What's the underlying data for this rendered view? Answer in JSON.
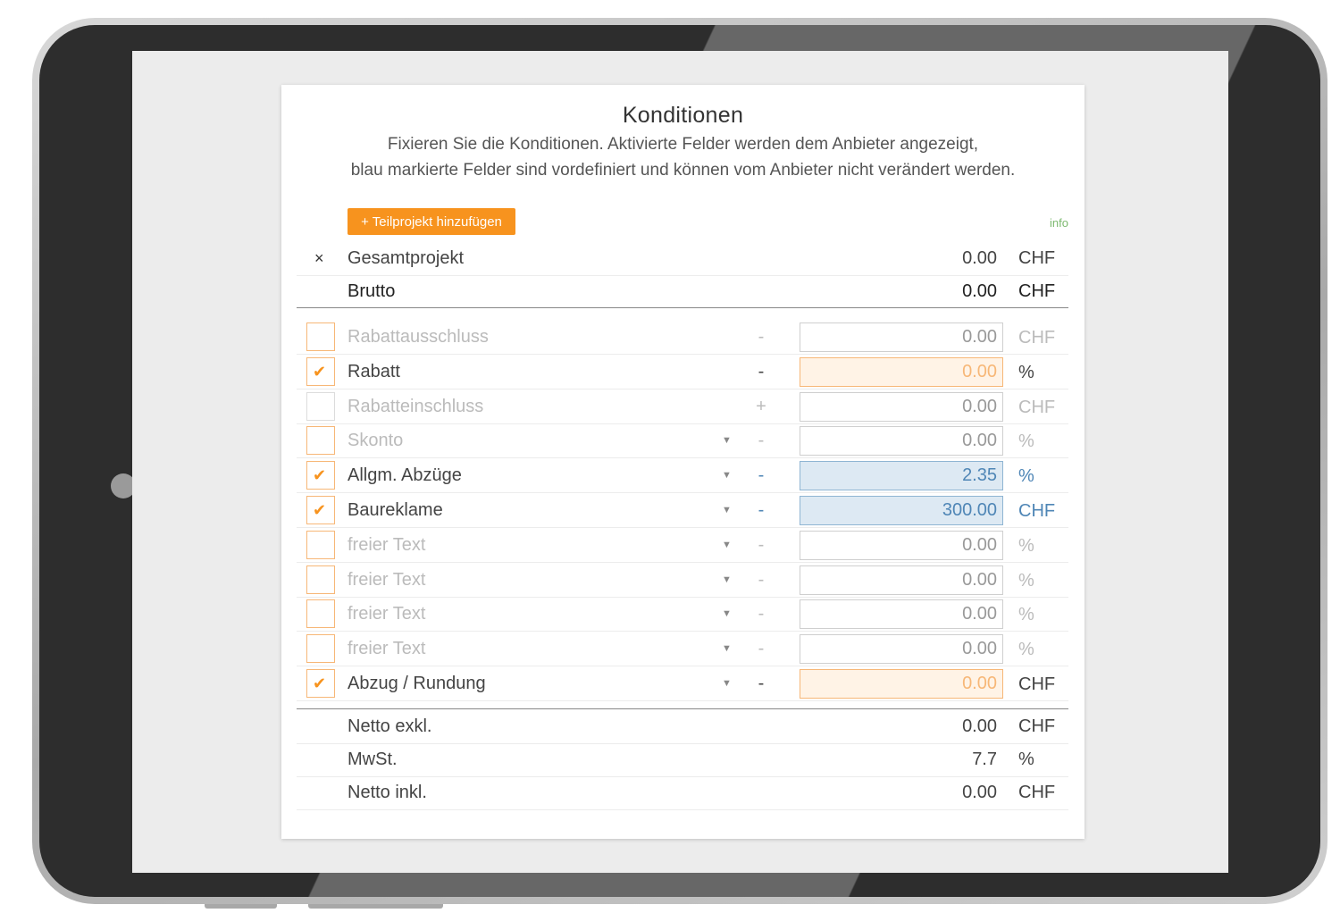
{
  "header": {
    "title": "Konditionen",
    "subtitle_line1": "Fixieren Sie die Konditionen. Aktivierte Felder werden dem Anbieter angezeigt,",
    "subtitle_line2": "blau markierte Felder sind vordefiniert und können vom Anbieter nicht verändert werden."
  },
  "toolbar": {
    "add_label": "+ Teilprojekt hinzufügen",
    "info_label": "info"
  },
  "summary": {
    "gesamt": {
      "close": "×",
      "label": "Gesamtprojekt",
      "value": "0.00",
      "unit": "CHF"
    },
    "brutto": {
      "label": "Brutto",
      "value": "0.00",
      "unit": "CHF"
    }
  },
  "conditions": [
    {
      "label": "Rabattausschluss",
      "checked": false,
      "dropdown": false,
      "sign": "-",
      "value": "0.00",
      "unit": "CHF",
      "style": "plain"
    },
    {
      "label": "Rabatt",
      "checked": true,
      "dropdown": false,
      "sign": "-",
      "value": "0.00",
      "unit": "%",
      "style": "orange"
    },
    {
      "label": "Rabatteinschluss",
      "checked": false,
      "dropdown": false,
      "sign": "+",
      "value": "0.00",
      "unit": "CHF",
      "style": "plain"
    },
    {
      "label": "Skonto",
      "checked": false,
      "dropdown": true,
      "sign": "-",
      "value": "0.00",
      "unit": "%",
      "style": "plain"
    },
    {
      "label": "Allgm. Abzüge",
      "checked": true,
      "dropdown": true,
      "sign": "-",
      "value": "2.35",
      "unit": "%",
      "style": "blue"
    },
    {
      "label": "Baureklame",
      "checked": true,
      "dropdown": true,
      "sign": "-",
      "value": "300.00",
      "unit": "CHF",
      "style": "blue"
    },
    {
      "label": "freier Text",
      "checked": false,
      "dropdown": true,
      "sign": "-",
      "value": "0.00",
      "unit": "%",
      "style": "plain"
    },
    {
      "label": "freier Text",
      "checked": false,
      "dropdown": true,
      "sign": "-",
      "value": "0.00",
      "unit": "%",
      "style": "plain"
    },
    {
      "label": "freier Text",
      "checked": false,
      "dropdown": true,
      "sign": "-",
      "value": "0.00",
      "unit": "%",
      "style": "plain"
    },
    {
      "label": "freier Text",
      "checked": false,
      "dropdown": true,
      "sign": "-",
      "value": "0.00",
      "unit": "%",
      "style": "plain"
    },
    {
      "label": "Abzug / Rundung",
      "checked": true,
      "dropdown": true,
      "sign": "-",
      "value": "0.00",
      "unit": "CHF",
      "style": "orange"
    }
  ],
  "icons": {
    "check": "checkmark-icon",
    "dropdown": "caret-down-icon",
    "close": "close-icon"
  },
  "totals": [
    {
      "label": "Netto exkl.",
      "value": "0.00",
      "unit": "CHF"
    },
    {
      "label": "MwSt.",
      "value": "7.7",
      "unit": "%"
    },
    {
      "label": "Netto inkl.",
      "value": "0.00",
      "unit": "CHF"
    }
  ],
  "colors": {
    "accent": "#f7931e",
    "predefined_blue": "#4f86b6",
    "info_green": "#7cb96f"
  }
}
